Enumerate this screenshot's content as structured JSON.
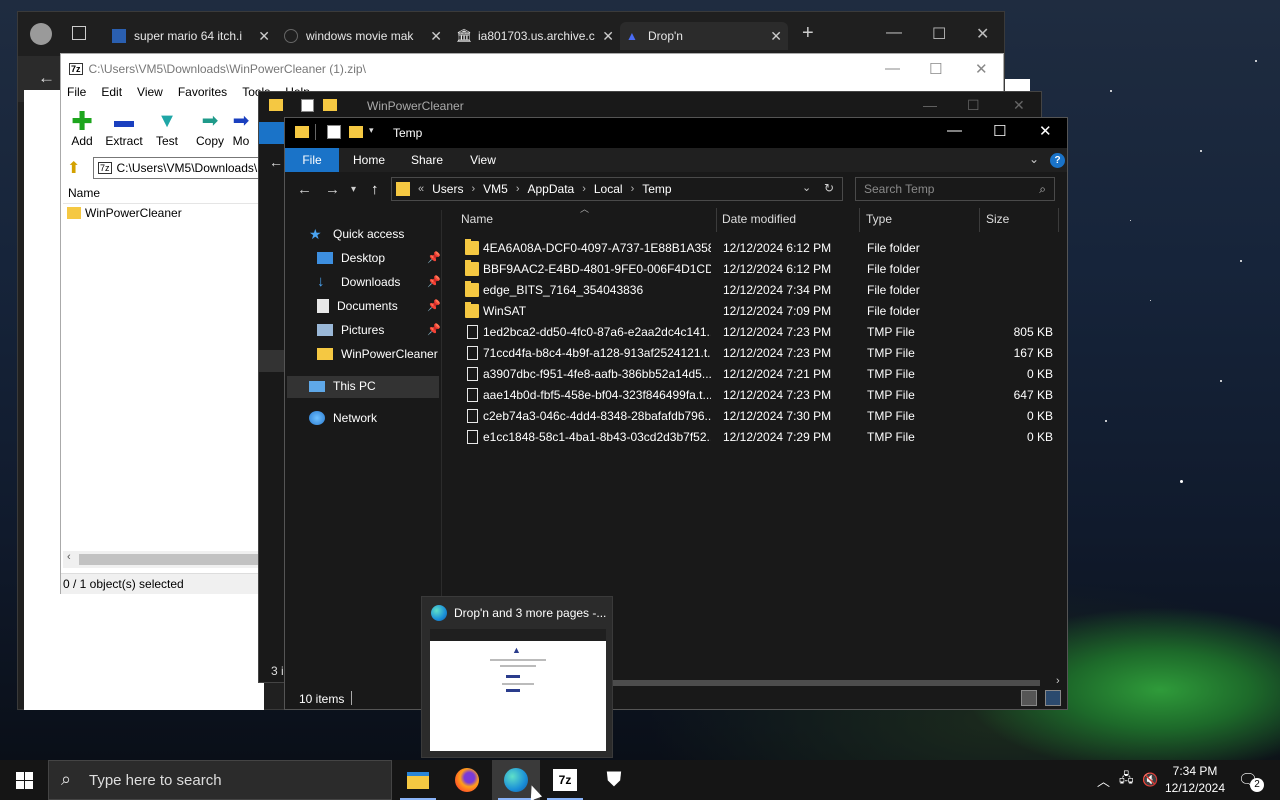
{
  "browser": {
    "tabs": [
      {
        "title": "super mario 64 itch.i",
        "icon": "itchio-icon"
      },
      {
        "title": "windows movie mak",
        "icon": "search-icon"
      },
      {
        "title": "ia801703.us.archive.c",
        "icon": "archive-icon"
      },
      {
        "title": "Drop'n",
        "icon": "dropn-icon"
      }
    ],
    "new_tab_glyph": "+"
  },
  "sevenzip": {
    "title": "C:\\Users\\VM5\\Downloads\\WinPowerCleaner (1).zip\\",
    "menu": [
      "File",
      "Edit",
      "View",
      "Favorites",
      "Tools",
      "Help"
    ],
    "toolbar": [
      {
        "label": "Add",
        "icon": "add-icon",
        "color": "#1da51d"
      },
      {
        "label": "Extract",
        "icon": "extract-icon",
        "color": "#1a3fbf"
      },
      {
        "label": "Test",
        "icon": "test-icon",
        "color": "#1fa6a6"
      },
      {
        "label": "Copy",
        "icon": "copy-icon",
        "color": "#1f9a8a"
      },
      {
        "label": "Mo",
        "icon": "move-icon",
        "color": "#1a3fbf"
      }
    ],
    "path": "C:\\Users\\VM5\\Downloads\\",
    "column_name": "Name",
    "items": [
      "WinPowerCleaner"
    ],
    "status": "0 / 1 object(s) selected"
  },
  "wpc_window": {
    "title": "WinPowerCleaner",
    "status": "3 i"
  },
  "explorer": {
    "title": "Temp",
    "ribbon_tabs": [
      "File",
      "Home",
      "Share",
      "View"
    ],
    "breadcrumb": [
      "Users",
      "VM5",
      "AppData",
      "Local",
      "Temp"
    ],
    "breadcrumb_prefix": "«",
    "search_placeholder": "Search Temp",
    "nav": {
      "quick_access": "Quick access",
      "pinned": [
        "Desktop",
        "Downloads",
        "Documents",
        "Pictures"
      ],
      "recent": "WinPowerCleaner",
      "this_pc": "This PC",
      "network": "Network"
    },
    "columns": [
      "Name",
      "Date modified",
      "Type",
      "Size"
    ],
    "files": [
      {
        "name": "4EA6A08A-DCF0-4097-A737-1E88B1A358...",
        "date": "12/12/2024 6:12 PM",
        "type": "File folder",
        "size": "",
        "kind": "folder"
      },
      {
        "name": "BBF9AAC2-E4BD-4801-9FE0-006F4D1CDE...",
        "date": "12/12/2024 6:12 PM",
        "type": "File folder",
        "size": "",
        "kind": "folder"
      },
      {
        "name": "edge_BITS_7164_354043836",
        "date": "12/12/2024 7:34 PM",
        "type": "File folder",
        "size": "",
        "kind": "folder"
      },
      {
        "name": "WinSAT",
        "date": "12/12/2024 7:09 PM",
        "type": "File folder",
        "size": "",
        "kind": "folder"
      },
      {
        "name": "1ed2bca2-dd50-4fc0-87a6-e2aa2dc4c141...",
        "date": "12/12/2024 7:23 PM",
        "type": "TMP File",
        "size": "805 KB",
        "kind": "file"
      },
      {
        "name": "71ccd4fa-b8c4-4b9f-a128-913af2524121.t...",
        "date": "12/12/2024 7:23 PM",
        "type": "TMP File",
        "size": "167 KB",
        "kind": "file"
      },
      {
        "name": "a3907dbc-f951-4fe8-aafb-386bb52a14d5....",
        "date": "12/12/2024 7:21 PM",
        "type": "TMP File",
        "size": "0 KB",
        "kind": "file"
      },
      {
        "name": "aae14b0d-fbf5-458e-bf04-323f846499fa.t...",
        "date": "12/12/2024 7:23 PM",
        "type": "TMP File",
        "size": "647 KB",
        "kind": "file"
      },
      {
        "name": "c2eb74a3-046c-4dd4-8348-28bafafdb796....",
        "date": "12/12/2024 7:30 PM",
        "type": "TMP File",
        "size": "0 KB",
        "kind": "file"
      },
      {
        "name": "e1cc1848-58c1-4ba1-8b43-03cd2d3b7f52...",
        "date": "12/12/2024 7:29 PM",
        "type": "TMP File",
        "size": "0 KB",
        "kind": "file"
      }
    ],
    "status": "10 items"
  },
  "preview": {
    "title": "Drop'n and 3 more pages -..."
  },
  "taskbar": {
    "search_placeholder": "Type here to search",
    "apps": [
      "file-explorer-icon",
      "firefox-icon",
      "edge-icon",
      "7zip-icon",
      "security-shield-icon"
    ],
    "time": "7:34 PM",
    "date": "12/12/2024",
    "notifications": "2",
    "sevenzip_label": "7z"
  }
}
